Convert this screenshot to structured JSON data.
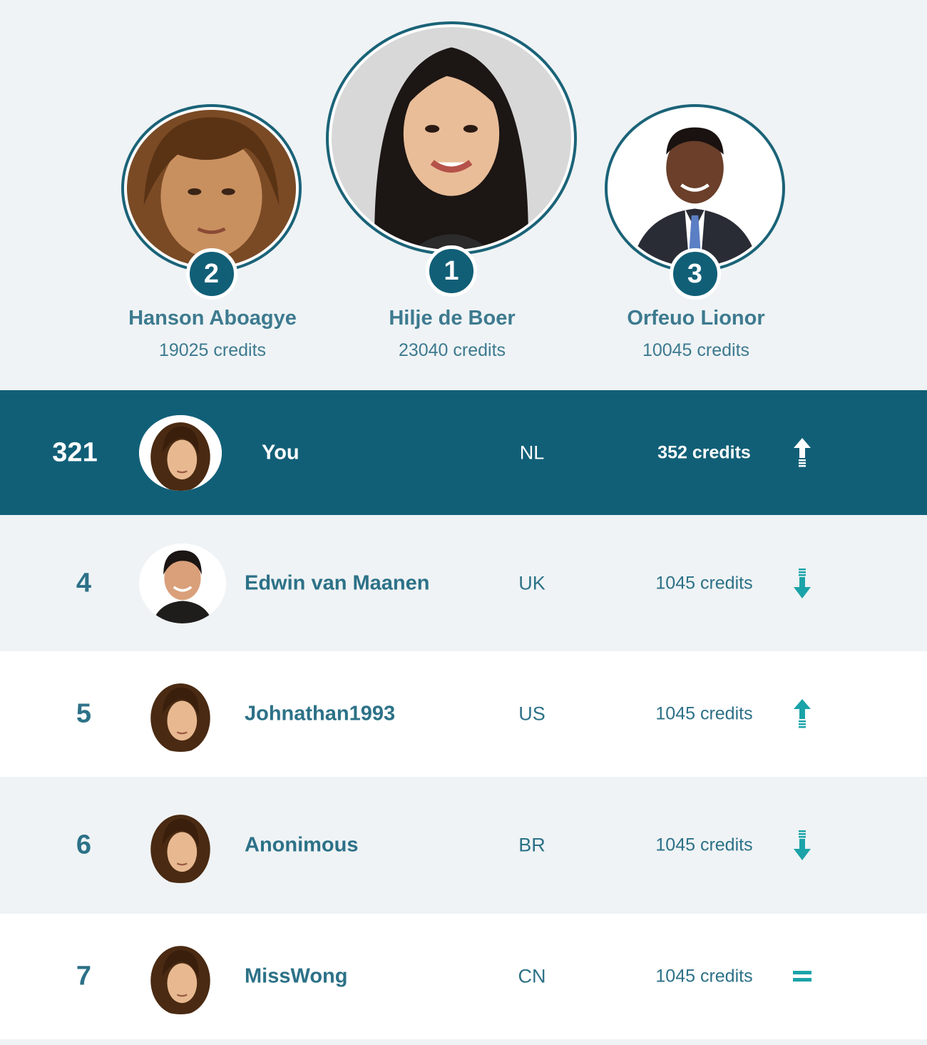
{
  "podium": [
    {
      "rank": "2",
      "name": "Hanson Aboagye",
      "credits": "19025 credits",
      "avatar": "long-brown-hair-man-avatar"
    },
    {
      "rank": "1",
      "name": "Hilje de Boer",
      "credits": "23040 credits",
      "avatar": "woman-dark-hair-avatar"
    },
    {
      "rank": "3",
      "name": "Orfeuo Lionor",
      "credits": "10045 credits",
      "avatar": "man-suit-avatar"
    }
  ],
  "leaderboard": [
    {
      "rank": "321",
      "name": "You",
      "country": "NL",
      "credits": "352 credits",
      "trend": "up",
      "trend_icon": "arrow-up-icon",
      "highlight": true
    },
    {
      "rank": "4",
      "name": "Edwin van Maanen",
      "country": "UK",
      "credits": "1045 credits",
      "trend": "down",
      "trend_icon": "arrow-down-icon"
    },
    {
      "rank": "5",
      "name": "Johnathan1993",
      "country": "US",
      "credits": "1045 credits",
      "trend": "up",
      "trend_icon": "arrow-up-icon"
    },
    {
      "rank": "6",
      "name": "Anonimous",
      "country": "BR",
      "credits": "1045 credits",
      "trend": "down",
      "trend_icon": "arrow-down-icon"
    },
    {
      "rank": "7",
      "name": "MissWong",
      "country": "CN",
      "credits": "1045 credits",
      "trend": "equal",
      "trend_icon": "equals-icon"
    }
  ],
  "colors": {
    "primary": "#115f77",
    "text": "#2c7187",
    "accent": "#1aa3a8",
    "background": "#eff3f5"
  }
}
